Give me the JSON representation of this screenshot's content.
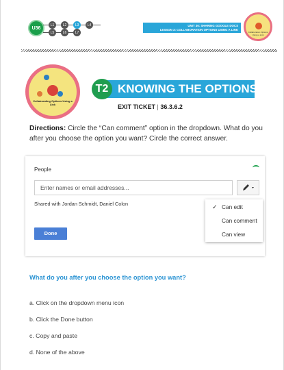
{
  "header": {
    "unit_badge": "U36",
    "lessons": [
      "L1",
      "L2",
      "L3",
      "L4",
      "L5",
      "L6",
      "L7"
    ],
    "active_lesson": "L3",
    "unit_title": "UNIT 36: SHARING GOOGLE DOCS",
    "lesson_title": "LESSON 3: COLLABORATION OPTIONS USING A LINK",
    "logo_caption": "Collaboration Options Using a Link"
  },
  "title": {
    "badge": "T2",
    "heading": "KNOWING THE OPTIONS",
    "exit_ticket_label": "EXIT TICKET",
    "separator": "|",
    "exit_ticket_code": "36.3.6.2",
    "logo_caption": "Collaborating Options Using a Link"
  },
  "directions": {
    "label": "Directions:",
    "text": "Circle the “Can comment” option in the dropdown. What do you after you choose the option you want? Circle the correct answer."
  },
  "dialog": {
    "people_label": "People",
    "input_placeholder": "Enter names or email addresses...",
    "shared_with": "Shared with Jordan Schmidt, Daniel Colon",
    "done_label": "Done",
    "menu": {
      "options": [
        "Can edit",
        "Can comment",
        "Can view"
      ],
      "checked": "Can edit"
    }
  },
  "question": {
    "prompt": "What do you after you choose the option you want?",
    "answers": [
      "a. Click on the dropdown menu icon",
      "b. Click the Done button",
      "c. Copy and paste",
      "d. None of the above"
    ]
  },
  "colors": {
    "accent_blue": "#29a6d9",
    "badge_green": "#1f9d4f",
    "logo_yellow": "#f4e47f",
    "logo_pink": "#ea6f84",
    "question_blue": "#2a93d3",
    "done_button": "#4a7fd6"
  }
}
